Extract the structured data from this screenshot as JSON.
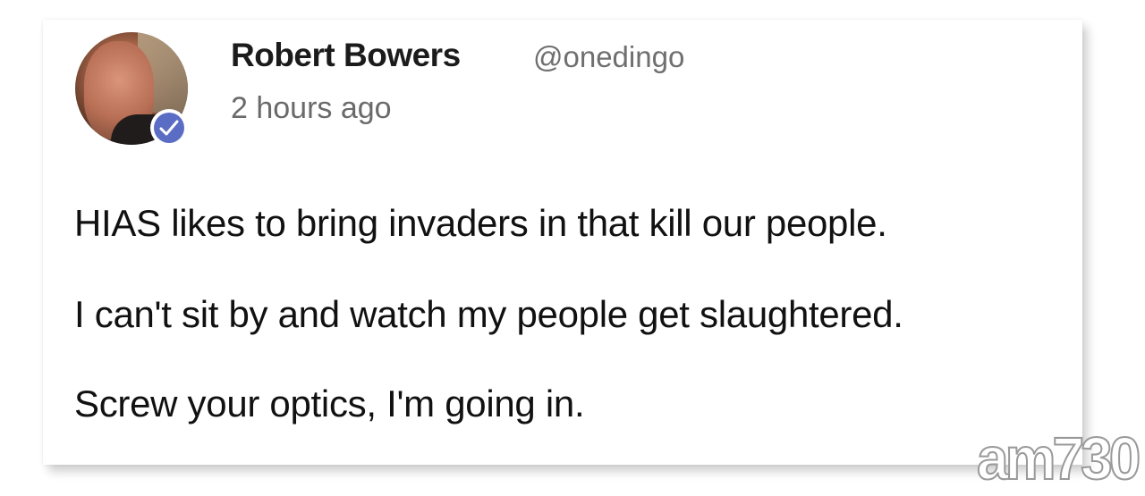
{
  "post": {
    "author_name": "Robert Bowers",
    "author_handle": "@onedingo",
    "timestamp": "2 hours ago",
    "avatar_icon": "user-avatar-photo",
    "verified_icon": "checkmark-badge-icon",
    "verified_color": "#5b6cc4",
    "body_lines": [
      "HIAS likes to bring invaders in that kill our people.",
      "I can't sit by and watch my people get slaughtered.",
      "Screw your optics, I'm going in."
    ]
  },
  "watermark": {
    "text": "am730"
  }
}
